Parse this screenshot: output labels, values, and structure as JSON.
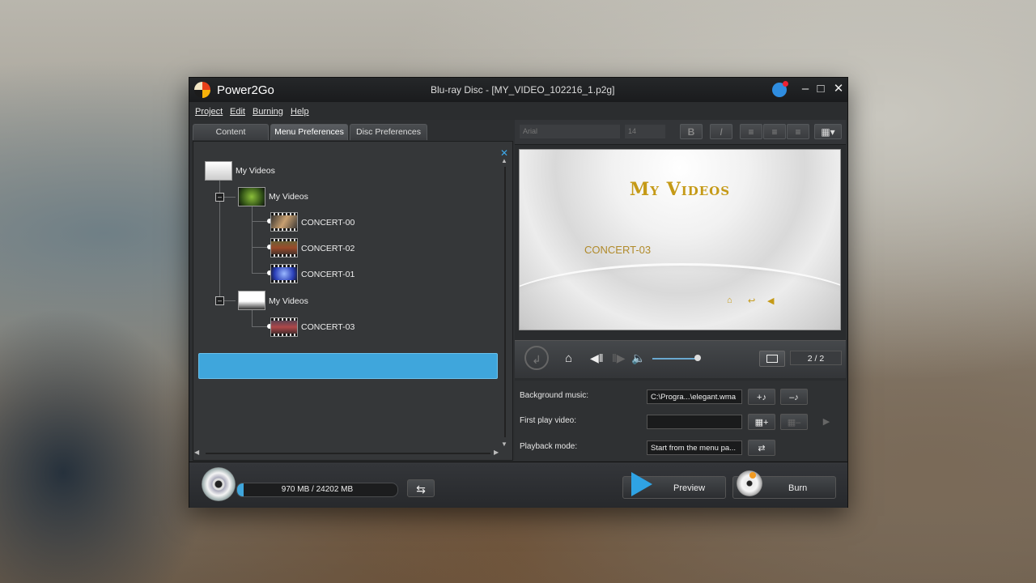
{
  "app": {
    "name": "Power2Go",
    "window_title": "Blu-ray Disc - [MY_VIDEO_102216_1.p2g]"
  },
  "menu": [
    "Project",
    "Edit",
    "Burning",
    "Help"
  ],
  "tabs": [
    "Content",
    "Menu Preferences",
    "Disc Preferences"
  ],
  "tree": {
    "root": "My Videos",
    "menu1": {
      "label": "My Videos",
      "children": [
        "CONCERT-00",
        "CONCERT-02",
        "CONCERT-01"
      ]
    },
    "menu2": {
      "label": "My Videos",
      "children": [
        "CONCERT-03"
      ]
    }
  },
  "toolbar": {
    "font": "Arial",
    "size": "14",
    "bold": "B",
    "italic": "I"
  },
  "preview": {
    "title": "My Videos",
    "item": "CONCERT-03"
  },
  "transport": {
    "page": "2 / 2"
  },
  "props": {
    "background_music_label": "Background music:",
    "background_music_value": "C:\\Progra...\\elegant.wma",
    "first_play_label": "First play video:",
    "first_play_value": "",
    "playback_mode_label": "Playback mode:",
    "playback_mode_value": "Start from the menu pa..."
  },
  "capacity": {
    "text": "970 MB / 24202 MB",
    "used_fraction": 0.04
  },
  "buttons": {
    "preview": "Preview",
    "burn": "Burn"
  },
  "colors": {
    "accent": "#3fa6dc",
    "title_gold": "#c59a17"
  }
}
